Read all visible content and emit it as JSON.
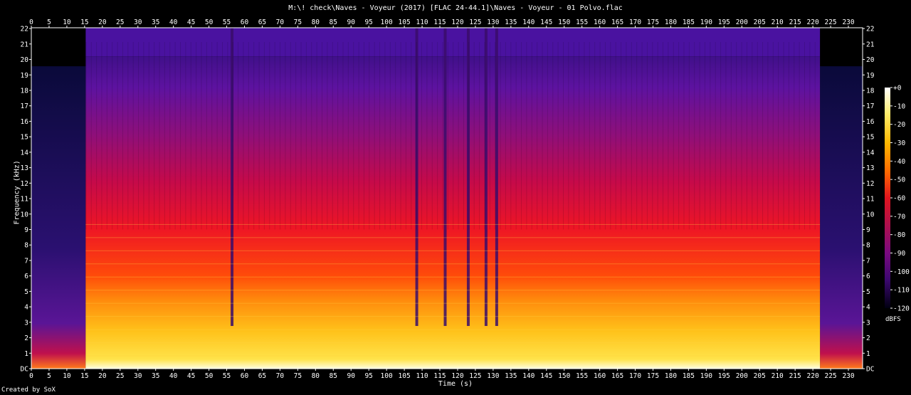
{
  "chart_data": {
    "type": "heatmap",
    "title": "M:\\! check\\Naves - Voyeur (2017) [FLAC 24-44.1]\\Naves - Voyeur - 01 Polvo.flac",
    "xlabel": "Time (s)",
    "ylabel": "Frequency (kHz)",
    "xlim": [
      0,
      234
    ],
    "ylim": [
      0,
      22.05
    ],
    "x_ticks": [
      0,
      5,
      10,
      15,
      20,
      25,
      30,
      35,
      40,
      45,
      50,
      55,
      60,
      65,
      70,
      75,
      80,
      85,
      90,
      95,
      100,
      105,
      110,
      115,
      120,
      125,
      130,
      135,
      140,
      145,
      150,
      155,
      160,
      165,
      170,
      175,
      180,
      185,
      190,
      195,
      200,
      205,
      210,
      215,
      220,
      225,
      230
    ],
    "y_ticks": [
      "DC",
      "1",
      "2",
      "3",
      "4",
      "5",
      "6",
      "7",
      "8",
      "9",
      "10",
      "11",
      "12",
      "13",
      "14",
      "15",
      "16",
      "17",
      "18",
      "19",
      "20",
      "21",
      "22"
    ],
    "colorbar": {
      "label": "dBFS",
      "ticks": [
        "+0",
        "-10",
        "-20",
        "-30",
        "-40",
        "-50",
        "-60",
        "-70",
        "-80",
        "-90",
        "-100",
        "-110",
        "-120"
      ],
      "range": [
        -120,
        0
      ]
    },
    "description_data": {
      "music_start_s": 15.3,
      "music_end_s": 222,
      "spectral_cutoff_khz": 20.2,
      "quiet_dips_s": [
        56.5,
        108.5,
        116.5,
        123,
        128,
        131
      ]
    },
    "footer": "Created by SoX"
  }
}
